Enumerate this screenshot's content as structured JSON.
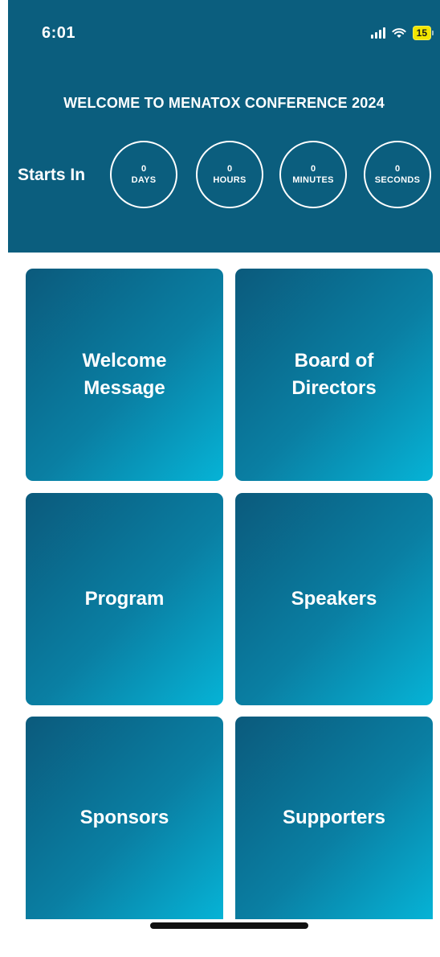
{
  "status_bar": {
    "time": "6:01",
    "battery_level": "15",
    "icons": [
      "signal-icon",
      "wifi-icon",
      "battery-icon"
    ]
  },
  "header": {
    "title": "WELCOME TO MENATOX CONFERENCE 2024",
    "starts_in_label": "Starts In",
    "countdown": [
      {
        "value": "0",
        "unit": "DAYS"
      },
      {
        "value": "0",
        "unit": "HOURS"
      },
      {
        "value": "0",
        "unit": "MINUTES"
      },
      {
        "value": "0",
        "unit": "SECONDS"
      }
    ]
  },
  "tiles": [
    {
      "label": "Welcome\nMessage"
    },
    {
      "label": "Board of\nDirectors"
    },
    {
      "label": "Program"
    },
    {
      "label": "Speakers"
    },
    {
      "label": "Sponsors"
    },
    {
      "label": "Supporters"
    }
  ],
  "colors": {
    "header_bg": "#0b5e7e",
    "tile_gradient_start": "#0b5a7c",
    "tile_gradient_end": "#06b3d6",
    "battery": "#f2e600"
  }
}
